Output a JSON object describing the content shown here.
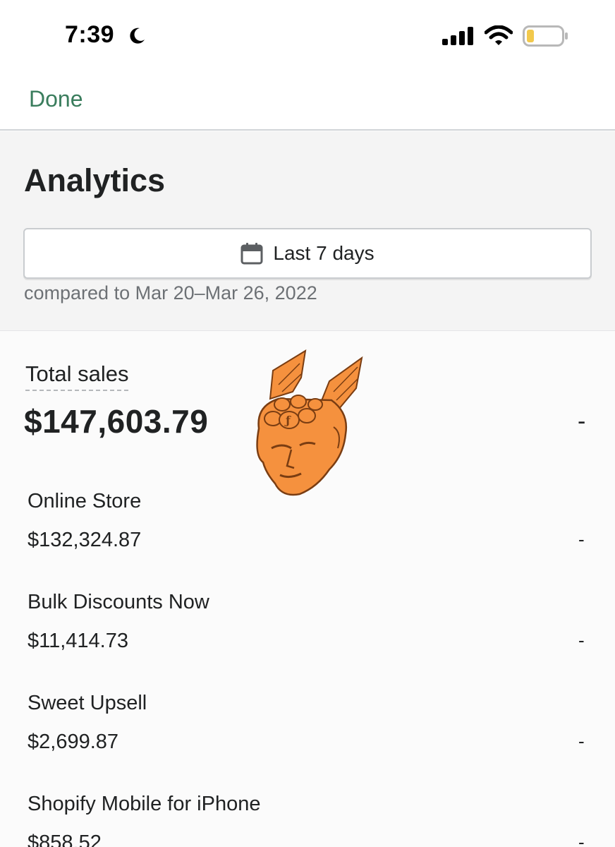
{
  "status_bar": {
    "time": "7:39",
    "icons": [
      "moon-icon",
      "cellular-signal-icon",
      "wifi-icon",
      "battery-low-icon"
    ],
    "battery_color": "#f2c94c"
  },
  "nav": {
    "done_label": "Done",
    "accent_color": "#3a7d5d"
  },
  "header": {
    "title": "Analytics",
    "date_range_label": "Last 7 days",
    "date_icon": "calendar-icon",
    "comparison_text": "compared to Mar 20–Mar 26, 2022"
  },
  "total_sales": {
    "label": "Total sales",
    "value": "$147,603.79",
    "change": "-"
  },
  "mascot": {
    "description_icon": "winged-head-logo-icon",
    "color": "#f5913e"
  },
  "channels": [
    {
      "name": "Online Store",
      "value": "$132,324.87",
      "change": "-"
    },
    {
      "name": "Bulk Discounts Now",
      "value": "$11,414.73",
      "change": "-"
    },
    {
      "name": "Sweet Upsell",
      "value": "$2,699.87",
      "change": "-"
    },
    {
      "name": "Shopify Mobile for iPhone",
      "value": "$858.52",
      "change": "-"
    }
  ]
}
